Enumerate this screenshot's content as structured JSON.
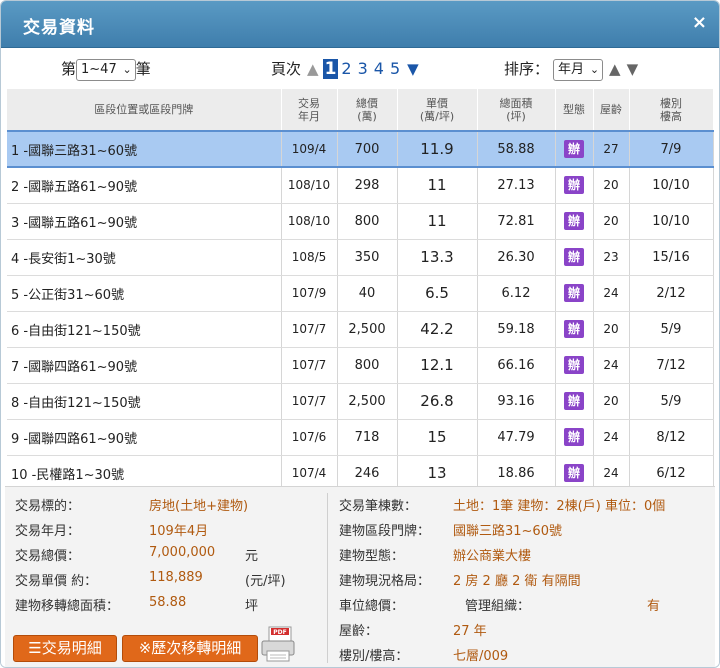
{
  "window": {
    "title": "交易資料",
    "close_glyph": "×"
  },
  "controls": {
    "record_prefix": "第",
    "record_select_value": "1~47",
    "record_suffix": "筆",
    "page_label": "頁次",
    "pages": [
      "1",
      "2",
      "3",
      "4",
      "5"
    ],
    "current_page": "1",
    "sort_label": "排序：",
    "sort_select_value": "年月"
  },
  "table": {
    "headers": [
      "區段位置或區段門牌",
      "交易年月",
      "總價(萬)",
      "單價(萬/坪)",
      "總面積(坪)",
      "型態",
      "屋齡",
      "樓別樓高"
    ],
    "headers_display": [
      [
        "區段位置或區段門牌"
      ],
      [
        "交易",
        "年月"
      ],
      [
        "總價",
        "(萬)"
      ],
      [
        "單價",
        "(萬/坪)"
      ],
      [
        "總面積",
        "(坪)"
      ],
      [
        "型態"
      ],
      [
        "屋齡"
      ],
      [
        "樓別",
        "樓高"
      ]
    ],
    "type_icon_text": "辦",
    "selected_row": 0,
    "rows": [
      {
        "addr": "1 -國聯三路31~60號",
        "date": "109/4",
        "total": "700",
        "unit": "11.9",
        "area": "58.88",
        "age": "27",
        "floor": "7/9"
      },
      {
        "addr": "2 -國聯五路61~90號",
        "date": "108/10",
        "total": "298",
        "unit": "11",
        "area": "27.13",
        "age": "20",
        "floor": "10/10"
      },
      {
        "addr": "3 -國聯五路61~90號",
        "date": "108/10",
        "total": "800",
        "unit": "11",
        "area": "72.81",
        "age": "20",
        "floor": "10/10"
      },
      {
        "addr": "4 -長安街1~30號",
        "date": "108/5",
        "total": "350",
        "unit": "13.3",
        "area": "26.30",
        "age": "23",
        "floor": "15/16"
      },
      {
        "addr": "5 -公正街31~60號",
        "date": "107/9",
        "total": "40",
        "unit": "6.5",
        "area": "6.12",
        "age": "24",
        "floor": "2/12"
      },
      {
        "addr": "6 -自由街121~150號",
        "date": "107/7",
        "total": "2,500",
        "unit": "42.2",
        "area": "59.18",
        "age": "20",
        "floor": "5/9"
      },
      {
        "addr": "7 -國聯四路61~90號",
        "date": "107/7",
        "total": "800",
        "unit": "12.1",
        "area": "66.16",
        "age": "24",
        "floor": "7/12"
      },
      {
        "addr": "8 -自由街121~150號",
        "date": "107/7",
        "total": "2,500",
        "unit": "26.8",
        "area": "93.16",
        "age": "20",
        "floor": "5/9"
      },
      {
        "addr": "9 -國聯四路61~90號",
        "date": "107/6",
        "total": "718",
        "unit": "15",
        "area": "47.79",
        "age": "24",
        "floor": "8/12"
      },
      {
        "addr": "10 -民權路1~30號",
        "date": "107/4",
        "total": "246",
        "unit": "13",
        "area": "18.86",
        "age": "24",
        "floor": "6/12"
      }
    ]
  },
  "detail": {
    "left": {
      "target_label": "交易標的：",
      "target_value": "房地(土地+建物)",
      "date_label": "交易年月：",
      "date_value": "109年4月",
      "total_label": "交易總價：",
      "total_value": "7,000,000",
      "total_unit": "元",
      "unit_label": "交易單價 約：",
      "unit_value": "118,889",
      "unit_unit": "(元/坪)",
      "area_label": "建物移轉總面積：",
      "area_value": "58.88",
      "area_unit": "坪"
    },
    "right": {
      "count_label": "交易筆棟數：",
      "count_value": "土地：1筆 建物：2棟(戶) 車位：0個",
      "address_label": "建物區段門牌：",
      "address_value": "國聯三路31~60號",
      "type_label": "建物型態：",
      "type_value": "辦公商業大樓",
      "layout_label": "建物現況格局：",
      "layout_value": "2 房 2 廳 2 衛 有隔間",
      "parking_label": "車位總價：",
      "mgmt_label": "管理組織：",
      "mgmt_value": "有",
      "age_label": "屋齡：",
      "age_value": "27 年",
      "floor_label": "樓別/樓高：",
      "floor_value": "七層/009"
    },
    "buttons": {
      "detail_label": "☰交易明細",
      "history_label": "※歷次移轉明細",
      "pdf_text": "PDF"
    }
  },
  "colors": {
    "title_bar": "#4a8bb8",
    "selected_row": "#a9caf2",
    "value_text": "#b05a10",
    "button": "#e0681a",
    "type_icon": "#8a44c8",
    "page_link": "#1a56a8"
  }
}
